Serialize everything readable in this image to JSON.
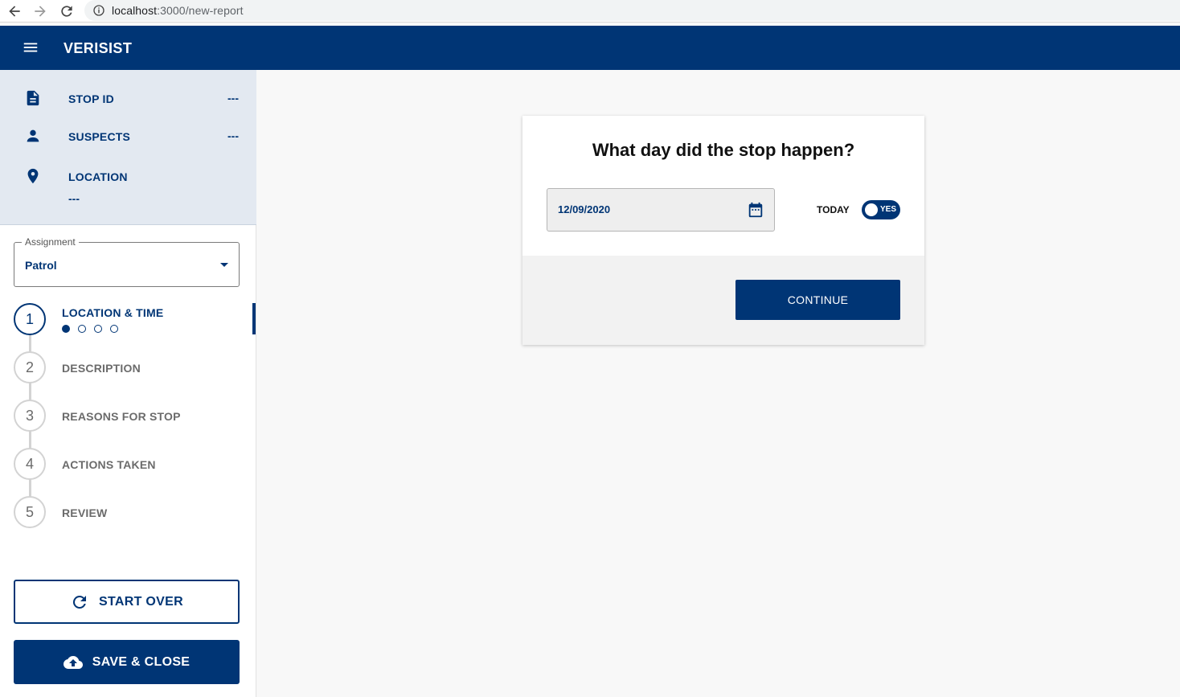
{
  "browser": {
    "url_host": "localhost",
    "url_path": ":3000/new-report"
  },
  "app": {
    "title": "VERISIST"
  },
  "summary": {
    "stop_id": {
      "label": "STOP ID",
      "value": "---"
    },
    "suspects": {
      "label": "SUSPECTS",
      "value": "---"
    },
    "location": {
      "label": "LOCATION",
      "value": "---"
    }
  },
  "assignment": {
    "legend": "Assignment",
    "value": "Patrol"
  },
  "steps": [
    {
      "number": "1",
      "label": "LOCATION & TIME",
      "active": true,
      "substeps_total": 4,
      "substep_current": 1
    },
    {
      "number": "2",
      "label": "DESCRIPTION"
    },
    {
      "number": "3",
      "label": "REASONS FOR STOP"
    },
    {
      "number": "4",
      "label": "ACTIONS TAKEN"
    },
    {
      "number": "5",
      "label": "REVIEW"
    }
  ],
  "buttons": {
    "start_over": "START OVER",
    "save_close": "SAVE & CLOSE",
    "continue": "CONTINUE"
  },
  "card": {
    "question": "What day did the stop happen?",
    "date_value": "12/09/2020",
    "today_label": "TODAY",
    "toggle_text": "YES",
    "toggle_on": true
  },
  "colors": {
    "primary": "#003575",
    "sidebar_summary_bg": "#e3e9f1",
    "page_bg": "#f8f8f8"
  },
  "icons": {
    "back": "arrow-left-icon",
    "forward": "arrow-right-icon",
    "reload": "reload-icon",
    "info": "info-icon",
    "menu": "hamburger-menu-icon",
    "stop_id": "document-icon",
    "suspects": "person-icon",
    "location": "map-pin-icon",
    "calendar": "calendar-icon",
    "start_over": "refresh-icon",
    "save_close": "cloud-upload-icon"
  }
}
